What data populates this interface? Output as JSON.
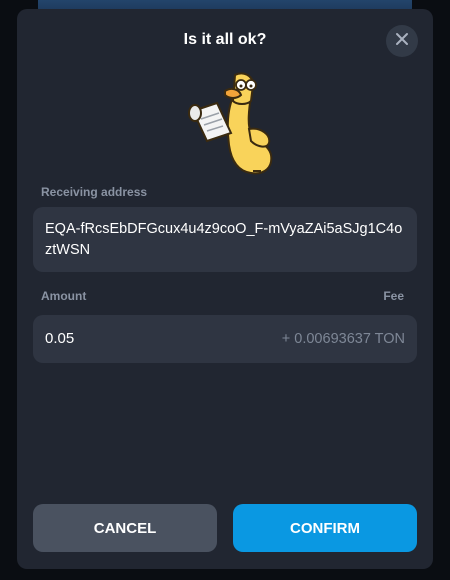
{
  "dialog": {
    "title": "Is it all ok?",
    "close_icon": "close-icon",
    "sticker_icon": "duck-reading-receipt-sticker"
  },
  "address": {
    "label": "Receiving address",
    "value": "EQA-fRcsEbDFGcux4u4z9coO_F-mVyaZAi5aSJg1C4oztWSN"
  },
  "amount": {
    "label": "Amount",
    "fee_label": "Fee",
    "value": "0.05",
    "fee": "+ 0.00693637 TON"
  },
  "actions": {
    "cancel_label": "CANCEL",
    "confirm_label": "CONFIRM"
  },
  "colors": {
    "modal_bg": "#212631",
    "field_bg": "#2f3542",
    "confirm_bg": "#0a98e2",
    "cancel_bg": "#4a5260"
  }
}
